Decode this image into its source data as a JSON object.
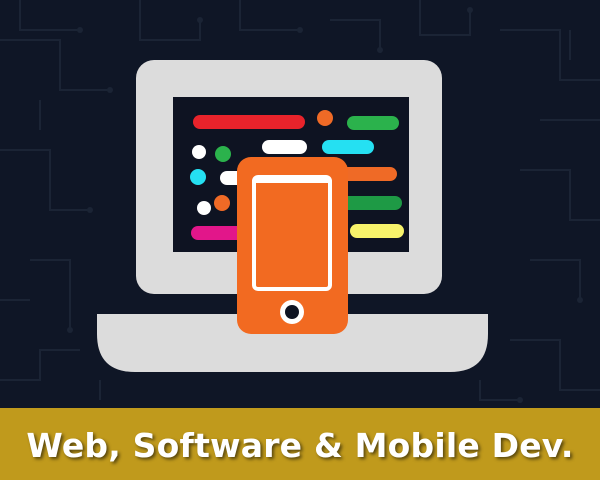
{
  "banner": {
    "title": "Web, Software & Mobile Dev.",
    "color": "#c09a1c"
  },
  "colors": {
    "background": "#0f1626",
    "circuit_lines": "#1b2435",
    "laptop_body": "#dcdcdc",
    "laptop_screen": "#0e1322",
    "phone": "#f26a21",
    "code_red": "#e8232b",
    "code_green": "#2bb24c",
    "code_white": "#ffffff",
    "code_cyan": "#25e0f2",
    "code_orange": "#ef6a26",
    "code_darkgreen": "#1e9a45",
    "code_magenta": "#e2168a",
    "code_yellow": "#f7f36b"
  },
  "icons": {
    "laptop": "laptop-icon",
    "phone": "smartphone-icon",
    "phone_button": "home-button-icon"
  }
}
